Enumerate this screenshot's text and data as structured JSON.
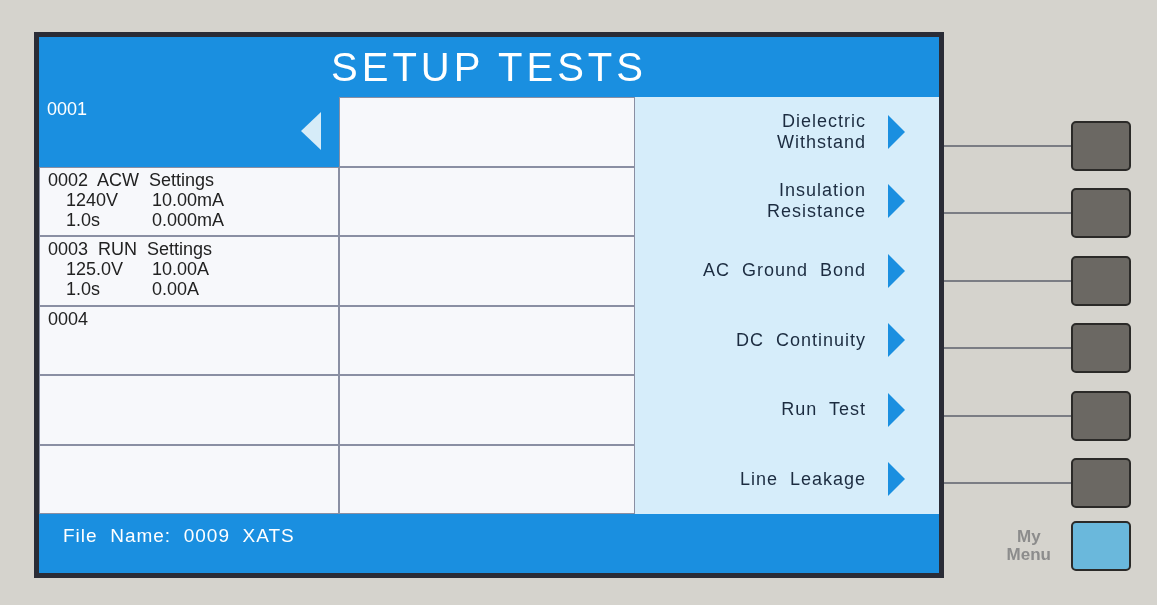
{
  "title": "SETUP TESTS",
  "steps": [
    {
      "heading": "0001",
      "selected": true
    },
    {
      "heading": "0002  ACW  Settings",
      "values": [
        [
          "1240V",
          "10.00mA"
        ],
        [
          "1.0s",
          "0.000mA"
        ]
      ],
      "selected": false
    },
    {
      "heading": "0003  RUN  Settings",
      "values": [
        [
          "125.0V",
          "10.00A"
        ],
        [
          "1.0s",
          "0.00A"
        ]
      ],
      "selected": false
    },
    {
      "heading": "0004",
      "selected": false
    },
    {
      "selected": false
    },
    {
      "selected": false
    }
  ],
  "softkeys": [
    {
      "lines": [
        "Dielectric",
        "Withstand"
      ]
    },
    {
      "lines": [
        "Insulation",
        "Resistance"
      ]
    },
    {
      "lines": [
        "AC  Ground  Bond"
      ]
    },
    {
      "lines": [
        "DC  Continuity"
      ]
    },
    {
      "lines": [
        "Run  Test"
      ]
    },
    {
      "lines": [
        "Line  Leakage"
      ]
    }
  ],
  "status_bar": {
    "file_name": "File  Name:  0009  XATS"
  },
  "panel_key": {
    "lines": [
      "My",
      "Menu"
    ]
  }
}
